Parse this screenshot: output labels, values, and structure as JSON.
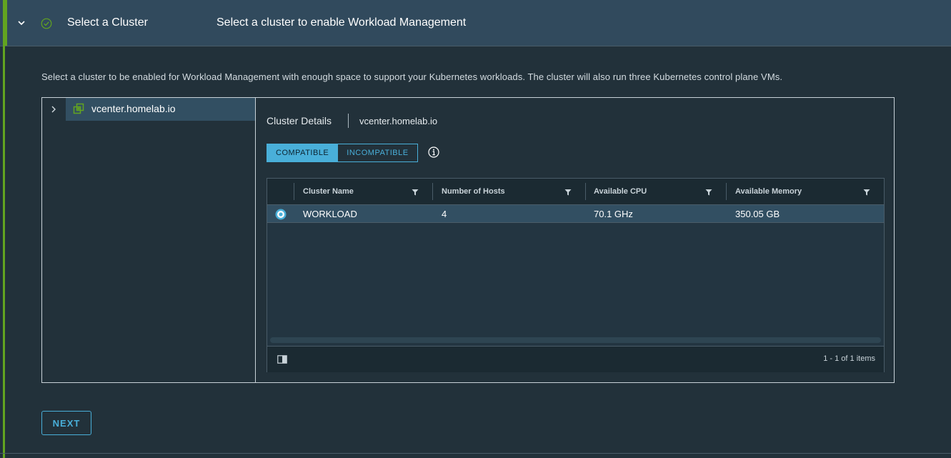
{
  "step": {
    "title": "Select a Cluster",
    "subtitle": "Select a cluster to enable Workload Management",
    "description": "Select a cluster to be enabled for Workload Management with enough space to support your Kubernetes workloads. The cluster will also run three Kubernetes control plane VMs.",
    "status_color": "#62a420"
  },
  "tree": {
    "root_label": "vcenter.homelab.io",
    "icon": "datacenter-icon"
  },
  "details": {
    "title": "Cluster Details",
    "subtitle": "vcenter.homelab.io",
    "tabs": [
      {
        "label": "COMPATIBLE",
        "active": true
      },
      {
        "label": "INCOMPATIBLE",
        "active": false
      }
    ]
  },
  "grid": {
    "columns": [
      "Cluster Name",
      "Number of Hosts",
      "Available CPU",
      "Available Memory"
    ],
    "rows": [
      {
        "selected": true,
        "name": "WORKLOAD",
        "hosts": "4",
        "cpu": "70.1 GHz",
        "memory": "350.05 GB"
      }
    ],
    "footer": "1 - 1 of 1 items"
  },
  "actions": {
    "next_label": "NEXT"
  },
  "colors": {
    "accent": "#49afd9",
    "header_bg": "#314a5d",
    "page_bg": "#22313a",
    "selected_row": "#324f62"
  }
}
